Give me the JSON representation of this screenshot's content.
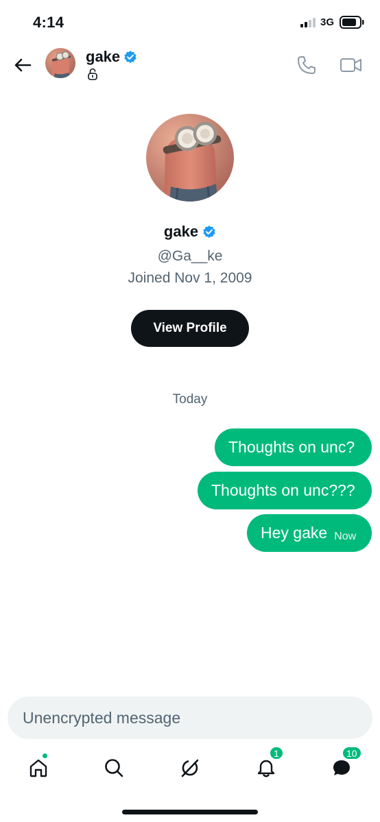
{
  "status_bar": {
    "time": "4:14",
    "network": "3G"
  },
  "header": {
    "name": "gake",
    "verified": true
  },
  "profile": {
    "name": "gake",
    "handle": "@Ga__ke",
    "joined": "Joined Nov 1, 2009",
    "view_profile_label": "View Profile"
  },
  "conversation": {
    "day_label": "Today",
    "messages": [
      {
        "text": "Thoughts on unc?"
      },
      {
        "text": "Thoughts on unc???"
      },
      {
        "text": "Hey gake",
        "time": "Now"
      }
    ]
  },
  "composer": {
    "placeholder": "Unencrypted message"
  },
  "tabbar": {
    "notifications_badge": "1",
    "messages_badge": "10"
  },
  "colors": {
    "accent": "#00ba7c",
    "verified": "#1d9bf0",
    "text_primary": "#0f1419",
    "text_secondary": "#536471"
  },
  "icons": [
    "back-arrow-icon",
    "lock-icon",
    "phone-icon",
    "video-icon",
    "verified-badge-icon",
    "home-icon",
    "search-icon",
    "grok-icon",
    "bell-icon",
    "messages-icon"
  ]
}
